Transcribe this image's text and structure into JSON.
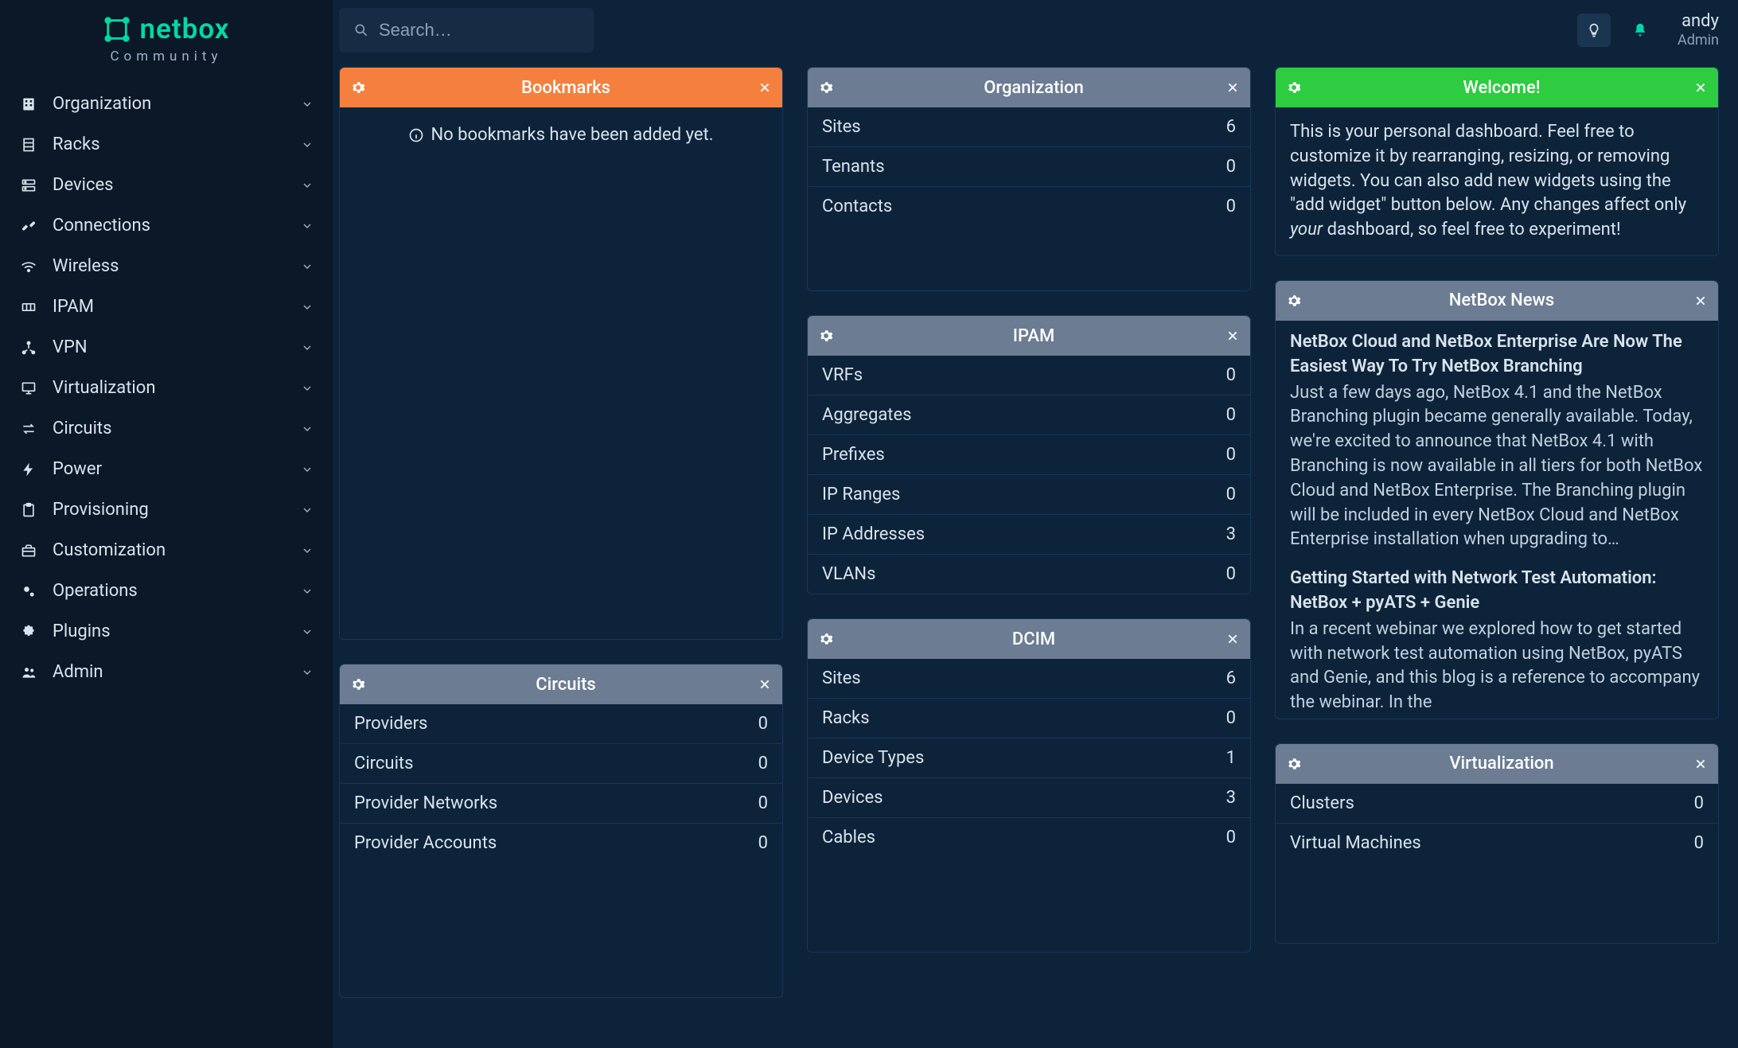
{
  "logo": {
    "brand": "netbox",
    "sub": "Community"
  },
  "search": {
    "placeholder": "Search…"
  },
  "user": {
    "name": "andy",
    "role": "Admin"
  },
  "nav": [
    {
      "label": "Organization"
    },
    {
      "label": "Racks"
    },
    {
      "label": "Devices"
    },
    {
      "label": "Connections"
    },
    {
      "label": "Wireless"
    },
    {
      "label": "IPAM"
    },
    {
      "label": "VPN"
    },
    {
      "label": "Virtualization"
    },
    {
      "label": "Circuits"
    },
    {
      "label": "Power"
    },
    {
      "label": "Provisioning"
    },
    {
      "label": "Customization"
    },
    {
      "label": "Operations"
    },
    {
      "label": "Plugins"
    },
    {
      "label": "Admin"
    }
  ],
  "widgets": {
    "bookmarks": {
      "title": "Bookmarks",
      "empty": "No bookmarks have been added yet."
    },
    "organization": {
      "title": "Organization",
      "rows": [
        {
          "label": "Sites",
          "value": "6"
        },
        {
          "label": "Tenants",
          "value": "0"
        },
        {
          "label": "Contacts",
          "value": "0"
        }
      ]
    },
    "welcome": {
      "title": "Welcome!",
      "text_pre": "This is your personal dashboard. Feel free to customize it by rearranging, resizing, or removing widgets. You can also add new widgets using the \"add widget\" button below. Any changes affect only ",
      "text_em": "your",
      "text_post": " dashboard, so feel free to experiment!"
    },
    "ipam": {
      "title": "IPAM",
      "rows": [
        {
          "label": "VRFs",
          "value": "0"
        },
        {
          "label": "Aggregates",
          "value": "0"
        },
        {
          "label": "Prefixes",
          "value": "0"
        },
        {
          "label": "IP Ranges",
          "value": "0"
        },
        {
          "label": "IP Addresses",
          "value": "3"
        },
        {
          "label": "VLANs",
          "value": "0"
        }
      ]
    },
    "news": {
      "title": "NetBox News",
      "items": [
        {
          "title": "NetBox Cloud and NetBox Enterprise Are Now The Easiest Way To Try NetBox Branching",
          "body": "Just a few days ago, NetBox 4.1 and the NetBox Branching plugin became generally available. Today, we're excited to announce that NetBox 4.1 with Branching is now available in all tiers for both NetBox Cloud and NetBox Enterprise.  The Branching plugin will be included in every NetBox Cloud and NetBox Enterprise installation when upgrading to…"
        },
        {
          "title": "Getting Started with Network Test Automation: NetBox + pyATS + Genie",
          "body": "In a recent webinar we explored how to get started with network test automation using NetBox, pyATS and Genie, and this blog is a reference to accompany the webinar. In the"
        }
      ]
    },
    "circuits": {
      "title": "Circuits",
      "rows": [
        {
          "label": "Providers",
          "value": "0"
        },
        {
          "label": "Circuits",
          "value": "0"
        },
        {
          "label": "Provider Networks",
          "value": "0"
        },
        {
          "label": "Provider Accounts",
          "value": "0"
        }
      ]
    },
    "dcim": {
      "title": "DCIM",
      "rows": [
        {
          "label": "Sites",
          "value": "6"
        },
        {
          "label": "Racks",
          "value": "0"
        },
        {
          "label": "Device Types",
          "value": "1"
        },
        {
          "label": "Devices",
          "value": "3"
        },
        {
          "label": "Cables",
          "value": "0"
        }
      ]
    },
    "virtualization": {
      "title": "Virtualization",
      "rows": [
        {
          "label": "Clusters",
          "value": "0"
        },
        {
          "label": "Virtual Machines",
          "value": "0"
        }
      ]
    }
  }
}
